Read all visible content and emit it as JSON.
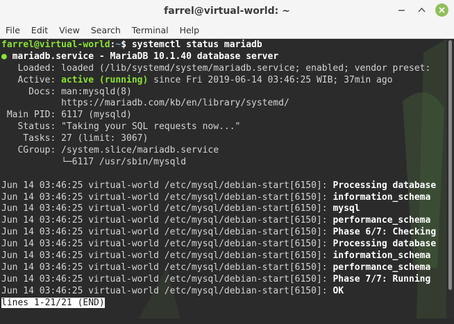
{
  "window": {
    "title": "farrel@virtual-world: ~"
  },
  "menu": [
    "File",
    "Edit",
    "View",
    "Search",
    "Terminal",
    "Help"
  ],
  "controls": {
    "minimize_icon": "minimize-icon",
    "maximize_icon": "maximize-icon",
    "close_icon": "close-icon"
  },
  "colors": {
    "prompt_user": "#8ae234",
    "prompt_path": "#729fcf",
    "status_active": "#8ae234",
    "terminal_bg": "#2b2b2b",
    "close_button": "#8fbf5a"
  },
  "terminal": {
    "prompt": {
      "user_host": "farrel@virtual-world",
      "sep": ":",
      "path": "~",
      "symbol": "$",
      "command": " systemctl status mariadb"
    },
    "service_line": {
      "dot": "●",
      "text": " mariadb.service - MariaDB 10.1.40 database server"
    },
    "loaded": "   Loaded: loaded (/lib/systemd/system/mariadb.service; enabled; vendor preset:",
    "active": {
      "label": "   Active: ",
      "state": "active (running)",
      "rest": " since Fri 2019-06-14 03:46:25 WIB; 37min ago"
    },
    "docs": [
      "     Docs: man:mysqld(8)",
      "           https://mariadb.com/kb/en/library/systemd/"
    ],
    "info": [
      " Main PID: 6117 (mysqld)",
      "   Status: \"Taking your SQL requests now...\"",
      "    Tasks: 27 (limit: 3067)",
      "   CGroup: /system.slice/mariadb.service",
      "           └─6117 /usr/sbin/mysqld"
    ],
    "blank": "",
    "logs": [
      {
        "prefix": "Jun 14 03:46:25 virtual-world /etc/mysql/debian-start[6150]: ",
        "msg": "Processing database"
      },
      {
        "prefix": "Jun 14 03:46:25 virtual-world /etc/mysql/debian-start[6150]: ",
        "msg": "information_schema"
      },
      {
        "prefix": "Jun 14 03:46:25 virtual-world /etc/mysql/debian-start[6150]: ",
        "msg": "mysql"
      },
      {
        "prefix": "Jun 14 03:46:25 virtual-world /etc/mysql/debian-start[6150]: ",
        "msg": "performance_schema"
      },
      {
        "prefix": "Jun 14 03:46:25 virtual-world /etc/mysql/debian-start[6150]: ",
        "msg": "Phase 6/7: Checking"
      },
      {
        "prefix": "Jun 14 03:46:25 virtual-world /etc/mysql/debian-start[6150]: ",
        "msg": "Processing database"
      },
      {
        "prefix": "Jun 14 03:46:25 virtual-world /etc/mysql/debian-start[6150]: ",
        "msg": "information_schema"
      },
      {
        "prefix": "Jun 14 03:46:25 virtual-world /etc/mysql/debian-start[6150]: ",
        "msg": "performance_schema"
      },
      {
        "prefix": "Jun 14 03:46:25 virtual-world /etc/mysql/debian-start[6150]: ",
        "msg": "Phase 7/7: Running"
      },
      {
        "prefix": "Jun 14 03:46:25 virtual-world /etc/mysql/debian-start[6150]: ",
        "msg": "OK"
      }
    ],
    "pager_status": "lines 1-21/21 (END)"
  }
}
